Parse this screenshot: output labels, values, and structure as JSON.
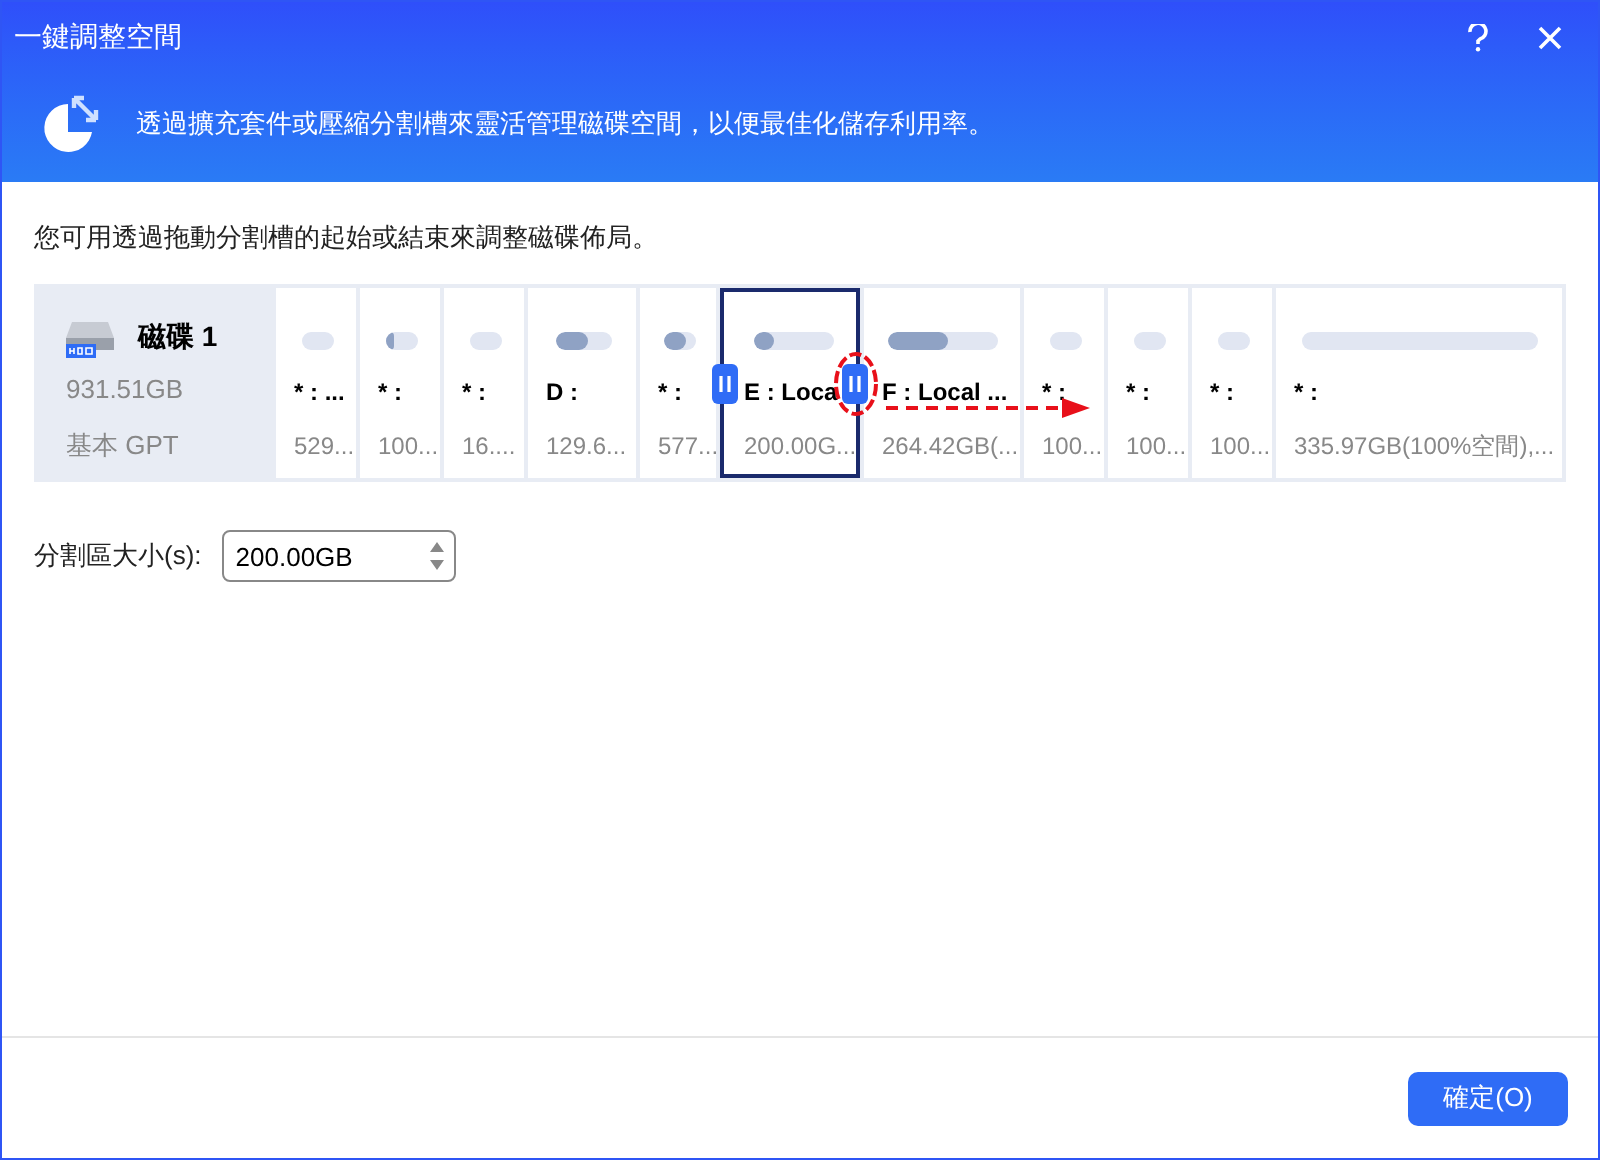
{
  "window": {
    "title": "一鍵調整空間"
  },
  "banner": {
    "text": "透過擴充套件或壓縮分割槽來靈活管理磁碟空間，以便最佳化儲存利用率。"
  },
  "instruction": "您可用透過拖動分割槽的起始或結束來調整磁碟佈局。",
  "disk": {
    "name": "磁碟 1",
    "size": "931.51GB",
    "type": "基本 GPT"
  },
  "partitions": [
    {
      "label": "* : ...",
      "size": "529...",
      "selected": false
    },
    {
      "label": "* :",
      "size": "100...",
      "level": 0.3,
      "selected": false
    },
    {
      "label": "* :",
      "size": "16....",
      "selected": false
    },
    {
      "label": "D :",
      "size": "129.6...",
      "level": 0.6,
      "selected": false
    },
    {
      "label": "* :",
      "size": "577...",
      "level": 0.7,
      "selected": false
    },
    {
      "label": "E : Loca",
      "size": "200.00G...",
      "level": 0.25,
      "selected": true
    },
    {
      "label": "F : Local ...",
      "size": "264.42GB(...",
      "level": 0.55,
      "selected": false
    },
    {
      "label": "* :",
      "size": "100...",
      "selected": false
    },
    {
      "label": "* :",
      "size": "100...",
      "selected": false
    },
    {
      "label": "* :",
      "size": "100...",
      "selected": false
    },
    {
      "label": "* :",
      "size": "335.97GB(100%空間),...",
      "selected": false
    }
  ],
  "size_field": {
    "label": "分割區大小(s):",
    "value": "200.00GB"
  },
  "buttons": [
    "確定(O)"
  ]
}
